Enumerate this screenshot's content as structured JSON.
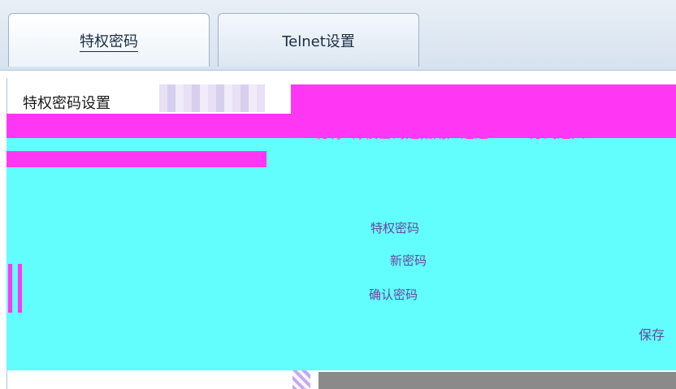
{
  "tabs": [
    {
      "label": "特权密码"
    },
    {
      "label": "Telnet设置"
    }
  ],
  "section": {
    "title": "特权密码设置"
  },
  "description": "说明: 特权密码是指用户通过Telnet方式进入",
  "fields": {
    "privilege_password_label": "特权密码",
    "new_password_label": "新密码",
    "confirm_password_label": "确认密码"
  },
  "actions": {
    "save_label": "保存"
  }
}
